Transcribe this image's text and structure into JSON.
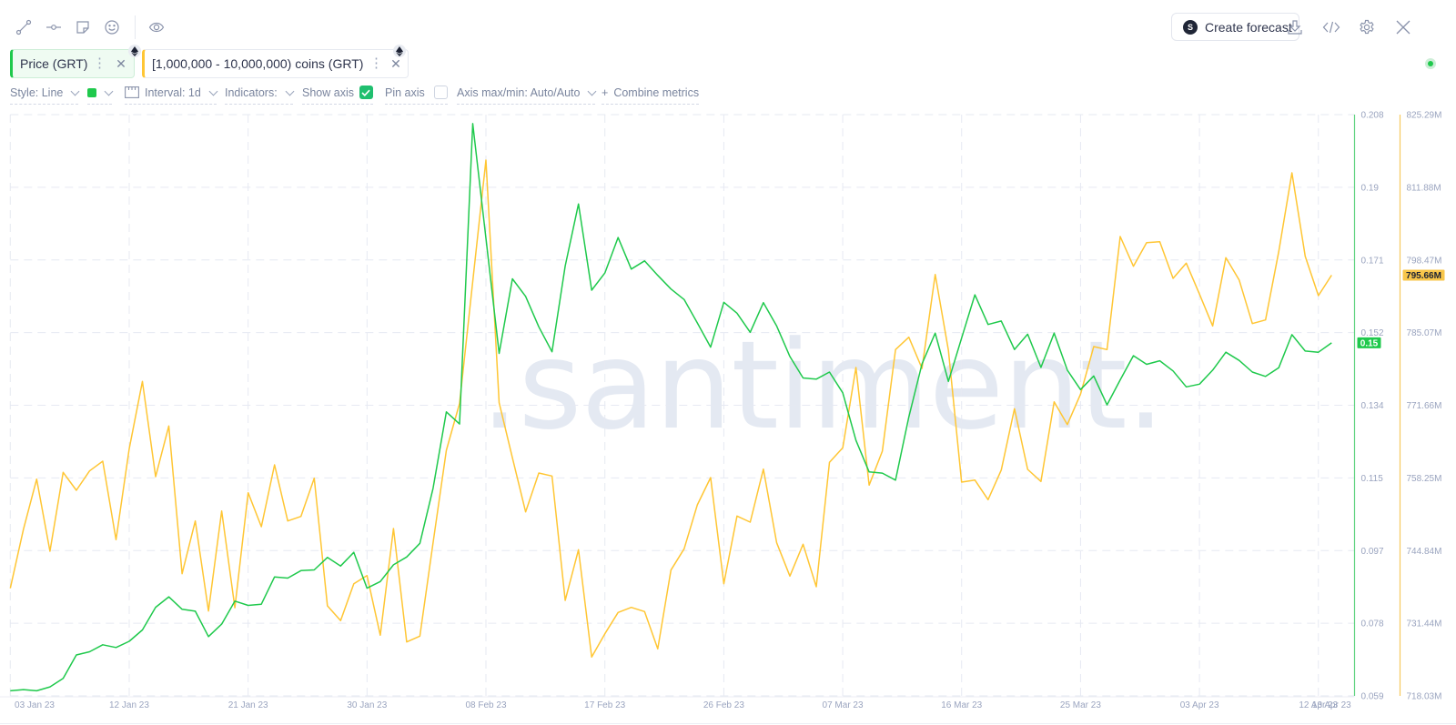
{
  "toolbar": {
    "left_icons": [
      "line-drawing-icon",
      "horizontal-ray-icon",
      "note-icon",
      "emoji-icon",
      "eye-icon"
    ],
    "create_forecast_label": "Create forecast",
    "create_forecast_logo": "S",
    "right_icons": [
      "download-icon",
      "embed-code-icon",
      "settings-gear-icon",
      "close-icon"
    ]
  },
  "metrics": [
    {
      "label": "Price (GRT)",
      "color": "#1fc94c",
      "chain_icon": "ethereum-icon"
    },
    {
      "label": "[1,000,000 - 10,000,000) coins (GRT)",
      "color": "#ffc634",
      "chain_icon": "ethereum-icon"
    }
  ],
  "settings": {
    "style_label": "Style: Line",
    "color_value": "#1fc94c",
    "interval_label": "Interval: 1d",
    "indicators_label": "Indicators:",
    "show_axis_label": "Show axis",
    "show_axis_checked": true,
    "pin_axis_label": "Pin axis",
    "pin_axis_checked": false,
    "axis_minmax_label": "Axis max/min: Auto/Auto",
    "combine_plus": "+",
    "combine_label": "Combine metrics"
  },
  "watermark": ".santiment.",
  "chart_data": {
    "type": "line",
    "title": "",
    "x_start": "2023-01-03",
    "interval_days": 1,
    "xlabel": "",
    "xticks": [
      {
        "day": 0,
        "label": "03 Jan 23"
      },
      {
        "day": 9,
        "label": "12 Jan 23"
      },
      {
        "day": 18,
        "label": "21 Jan 23"
      },
      {
        "day": 27,
        "label": "30 Jan 23"
      },
      {
        "day": 36,
        "label": "08 Feb 23"
      },
      {
        "day": 45,
        "label": "17 Feb 23"
      },
      {
        "day": 54,
        "label": "26 Feb 23"
      },
      {
        "day": 63,
        "label": "07 Mar 23"
      },
      {
        "day": 72,
        "label": "16 Mar 23"
      },
      {
        "day": 81,
        "label": "25 Mar 23"
      },
      {
        "day": 90,
        "label": "03 Apr 23"
      },
      {
        "day": 99,
        "label": "12 Apr 23"
      },
      {
        "day": 100,
        "label": "13 Apr 23"
      }
    ],
    "grid": true,
    "legend": "top-left",
    "series": [
      {
        "name": "Price (GRT)",
        "color": "#1fc94c",
        "axis_color": "#5fd27f",
        "axis": "right-1",
        "ylim": [
          0.059,
          0.208
        ],
        "yticks": [
          "0.208",
          "0.19",
          "0.171",
          "0.152",
          "0.134",
          "0.115",
          "0.097",
          "0.078",
          "0.059"
        ],
        "last_value_label": "0.15",
        "values": [
          0.0603,
          0.0606,
          0.0603,
          0.0613,
          0.0635,
          0.0695,
          0.0703,
          0.0721,
          0.0714,
          0.073,
          0.0759,
          0.0817,
          0.0844,
          0.0812,
          0.0807,
          0.0742,
          0.0774,
          0.0833,
          0.0822,
          0.0825,
          0.0895,
          0.0892,
          0.0911,
          0.0913,
          0.0945,
          0.0923,
          0.0958,
          0.0866,
          0.0883,
          0.0926,
          0.0946,
          0.0981,
          0.1122,
          0.1318,
          0.1287,
          0.2057,
          0.1763,
          0.1468,
          0.1659,
          0.1614,
          0.1536,
          0.1472,
          0.1692,
          0.1851,
          0.163,
          0.1674,
          0.1765,
          0.1684,
          0.1705,
          0.1668,
          0.1633,
          0.1606,
          0.1546,
          0.1484,
          0.1599,
          0.1571,
          0.1522,
          0.1598,
          0.1538,
          0.146,
          0.1405,
          0.1402,
          0.142,
          0.1367,
          0.1245,
          0.1164,
          0.1161,
          0.1143,
          0.1305,
          0.1441,
          0.152,
          0.1396,
          0.1507,
          0.1618,
          0.1542,
          0.1551,
          0.1478,
          0.1517,
          0.1432,
          0.152,
          0.1425,
          0.1375,
          0.141,
          0.1336,
          0.14,
          0.1462,
          0.144,
          0.1449,
          0.1423,
          0.1382,
          0.1389,
          0.1425,
          0.1471,
          0.145,
          0.142,
          0.1409,
          0.1431,
          0.1516,
          0.1474,
          0.1471,
          0.1495
        ]
      },
      {
        "name": "[1,000,000 - 10,000,000) coins (GRT)",
        "color": "#ffc634",
        "axis_color": "#f6c95e",
        "axis": "right-2",
        "ylim": [
          718.03,
          825.29
        ],
        "yticks": [
          "825.29M",
          "811.88M",
          "798.47M",
          "785.07M",
          "771.66M",
          "758.25M",
          "744.84M",
          "731.44M",
          "718.03M"
        ],
        "last_value_label": "795.66M",
        "unit": "M",
        "values": [
          737.89,
          748.8,
          758.03,
          744.72,
          759.27,
          755.97,
          759.54,
          761.34,
          746.85,
          763.64,
          776.06,
          758.48,
          767.83,
          740.57,
          750.31,
          733.69,
          752.16,
          734.3,
          755.51,
          749.25,
          760.67,
          750.31,
          751.15,
          758.2,
          734.65,
          731.91,
          738.73,
          740.24,
          729.23,
          748.92,
          727.98,
          729.06,
          746.28,
          763.35,
          772.0,
          794.5,
          816.9,
          772.13,
          761.96,
          751.99,
          759.16,
          758.6,
          735.66,
          745.01,
          725.2,
          729.49,
          733.42,
          734.36,
          733.59,
          726.71,
          741.24,
          745.17,
          753.28,
          758.32,
          738.73,
          751.22,
          750.09,
          759.88,
          746.28,
          740.14,
          746.01,
          738.17,
          761.12,
          763.81,
          778.63,
          756.92,
          763.18,
          781.93,
          784.22,
          778.46,
          795.8,
          781.82,
          757.48,
          757.86,
          754.24,
          759.71,
          771.02,
          759.83,
          757.59,
          772.3,
          768.1,
          773.71,
          782.49,
          781.93,
          802.8,
          797.31,
          801.68,
          801.84,
          795.08,
          797.88,
          792.17,
          786.3,
          798.89,
          794.79,
          786.74,
          787.41,
          800.0,
          814.55,
          799.16,
          791.89,
          795.66
        ]
      }
    ]
  }
}
